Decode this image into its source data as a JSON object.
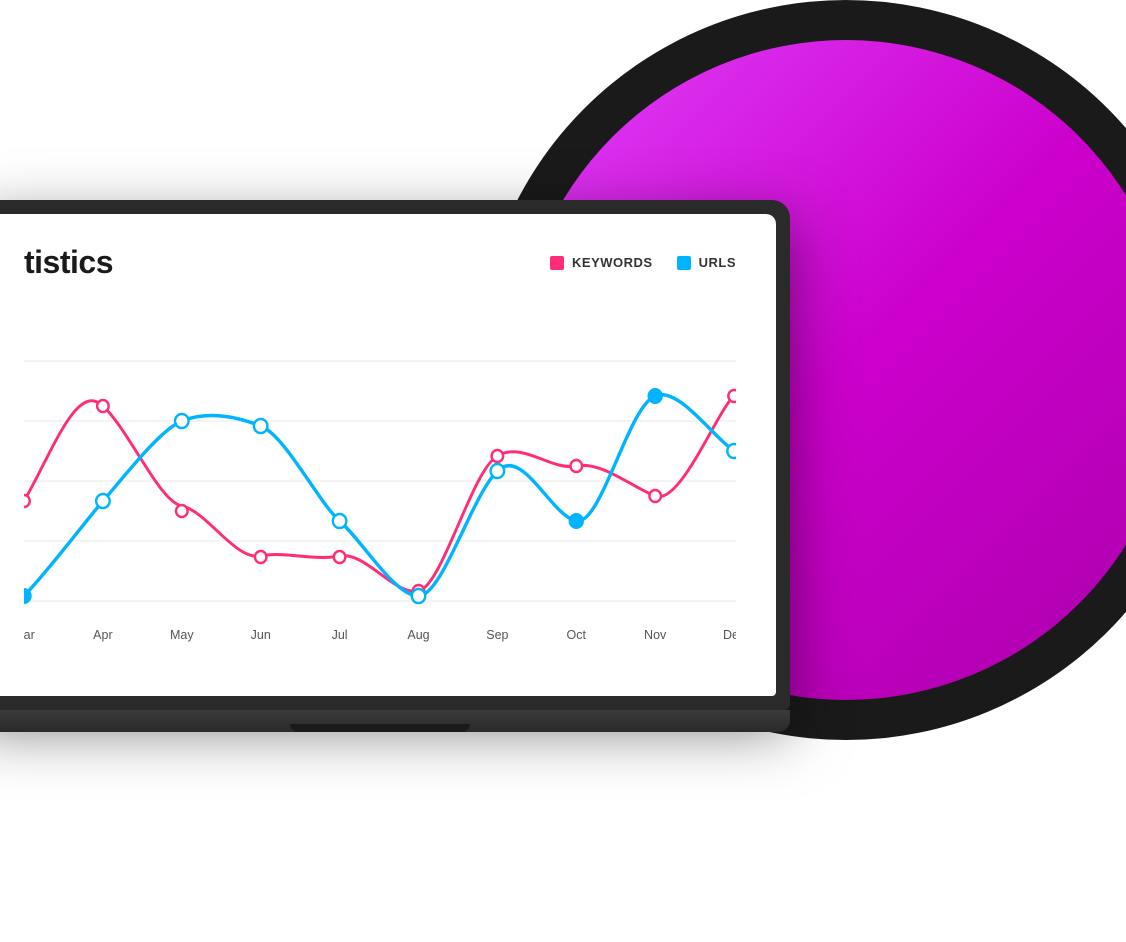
{
  "background": {
    "outer_circle_color": "#1a1a1a",
    "inner_circle_color": "#cc00cc"
  },
  "chart": {
    "title": "tistics",
    "legend": {
      "keywords_label": "KEYWORDS",
      "urls_label": "URLS",
      "keywords_color": "#ff2d78",
      "urls_color": "#00b4ff"
    },
    "months": [
      "Mar",
      "Apr",
      "May",
      "Jun",
      "Jul",
      "Aug",
      "Sep",
      "Oct",
      "Nov",
      "Dec"
    ],
    "grid_lines": 5,
    "keywords_series": "sinusoidal pink line with data points",
    "urls_series": "sinusoidal blue line with data points"
  }
}
